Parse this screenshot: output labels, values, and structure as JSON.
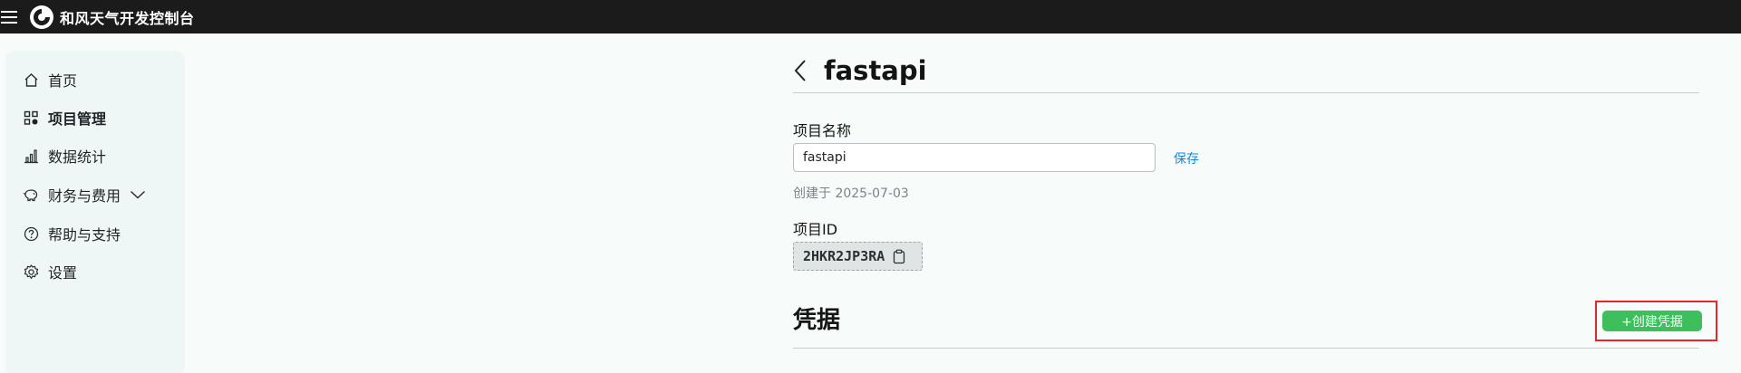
{
  "app": {
    "title": "和风天气开发控制台"
  },
  "sidebar": {
    "items": [
      {
        "label": "首页",
        "icon": "home-icon",
        "active": false
      },
      {
        "label": "项目管理",
        "icon": "grid-icon",
        "active": true
      },
      {
        "label": "数据统计",
        "icon": "bar-chart-icon",
        "active": false
      },
      {
        "label": "财务与费用",
        "icon": "piggy-bank-icon",
        "active": false,
        "expandable": true
      },
      {
        "label": "帮助与支持",
        "icon": "help-circle-icon",
        "active": false
      },
      {
        "label": "设置",
        "icon": "gear-icon",
        "active": false
      }
    ]
  },
  "project": {
    "title": "fastapi",
    "name_label": "项目名称",
    "name_value": "fastapi",
    "save_label": "保存",
    "created_text": "创建于 2025-07-03",
    "id_label": "项目ID",
    "id_value": "2HKR2JP3RA"
  },
  "credentials": {
    "title": "凭据",
    "create_label": "+创建凭据"
  },
  "colors": {
    "topbar": "#1b1b1b",
    "sidebar_bg": "#eef7f6",
    "accent_green": "#3dbf5b",
    "link_blue": "#1a87d6",
    "highlight_red": "#e8262a"
  }
}
